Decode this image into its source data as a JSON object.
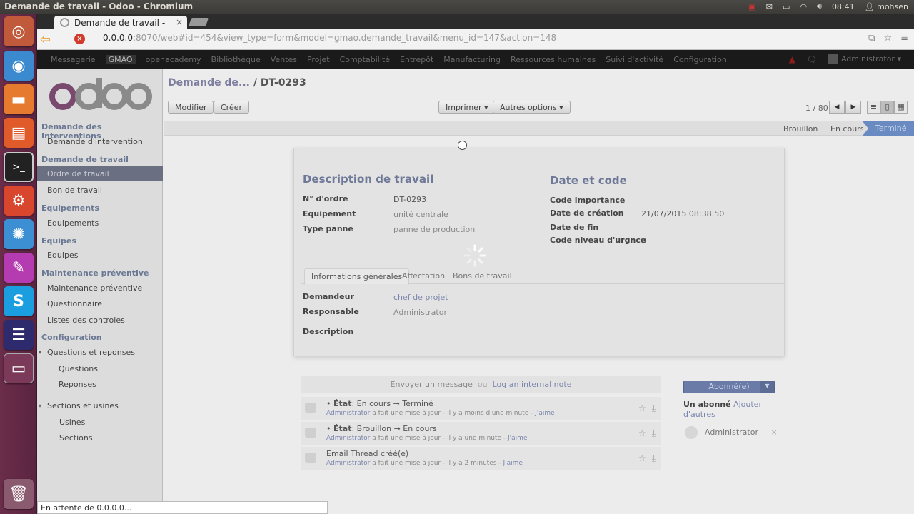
{
  "os": {
    "window_title": "Demande de travail - Odoo - Chromium",
    "clock": "08:41",
    "user": "mohsen"
  },
  "browser": {
    "tab_title": "Demande de travail -",
    "url_host": "0.0.0.0",
    "url_rest": ":8070/web#id=454&view_type=form&model=gmao.demande_travail&menu_id=147&action=148",
    "status_text": "En attente de 0.0.0.0..."
  },
  "topmenu": {
    "items": [
      "Messagerie",
      "GMAO",
      "openacademy",
      "Bibliothèque",
      "Ventes",
      "Projet",
      "Comptabilité",
      "Entrepôt",
      "Manufacturing",
      "Ressources humaines",
      "Suivi d'activité",
      "Configuration"
    ],
    "active": "GMAO",
    "user": "Administrator"
  },
  "sidebar": {
    "sections": [
      {
        "title": "Demande des Interventions",
        "items": [
          "Demande d'intervention"
        ]
      },
      {
        "title": "Demande de travail",
        "items": [
          "Ordre de travail",
          "Bon de travail"
        ]
      },
      {
        "title": "Equipements",
        "items": [
          "Equipements"
        ]
      },
      {
        "title": "Equipes",
        "items": [
          "Equipes"
        ]
      },
      {
        "title": "Maintenance préventive",
        "items": [
          "Maintenance préventive",
          "Questionnaire",
          "Listes des controles"
        ]
      },
      {
        "title": "Configuration",
        "items": [
          "Questions et reponses",
          "Questions",
          "Reponses",
          "Sections et usines",
          "Usines",
          "Sections"
        ]
      }
    ],
    "active_item": "Ordre de travail"
  },
  "header": {
    "breadcrumb_parent": "Demande de...",
    "breadcrumb_sep": "/",
    "breadcrumb_current": "DT-0293",
    "btn_edit": "Modifier",
    "btn_create": "Créer",
    "btn_print": "Imprimer",
    "btn_more": "Autres options",
    "pager": "1 / 80"
  },
  "states": [
    "Brouillon",
    "En cours",
    "Terminé"
  ],
  "active_state": "Terminé",
  "form": {
    "title_left": "Description de travail",
    "title_right": "Date et code",
    "fields_left": [
      {
        "label": "N° d'ordre",
        "value": "DT-0293"
      },
      {
        "label": "Equipement",
        "value": "unité centrale"
      },
      {
        "label": "Type panne",
        "value": "panne de production"
      }
    ],
    "fields_right": [
      {
        "label": "Code importance",
        "value": ""
      },
      {
        "label": "Date de création",
        "value": "21/07/2015 08:38:50"
      },
      {
        "label": "Date de fin",
        "value": ""
      },
      {
        "label": "Code niveau d'urgnce",
        "value": "0"
      }
    ],
    "tabs": [
      "Informations générales",
      "Affectation",
      "Bons de travail"
    ],
    "tab_fields": [
      {
        "label": "Demandeur",
        "value": "chef de projet"
      },
      {
        "label": "Responsable",
        "value": "Administrator"
      },
      {
        "label": "Description",
        "value": ""
      }
    ]
  },
  "chatter": {
    "send_message": "Envoyer un message",
    "or": "ou",
    "log_note": "Log an internal note",
    "messages": [
      {
        "line1_prefix": "• ",
        "field": "État",
        "change": ": En cours → Terminé",
        "author": "Administrator",
        "meta": " a fait une mise à jour - il y a moins d'une minute - ",
        "like": "J'aime"
      },
      {
        "line1_prefix": "• ",
        "field": "État",
        "change": ": Brouillon → En cours",
        "author": "Administrator",
        "meta": " a fait une mise à jour - il y a une minute - ",
        "like": "J'aime"
      },
      {
        "line1_prefix": "",
        "field": "",
        "change": "Email Thread créé(e)",
        "author": "Administrator",
        "meta": " a fait une mise à jour - il y a 2 minutes - ",
        "like": "J'aime"
      }
    ],
    "follow_btn": "Abonné(e)",
    "followers_count": "Un abonné",
    "add_others": "Ajouter d'autres",
    "follower_name": "Administrator"
  }
}
